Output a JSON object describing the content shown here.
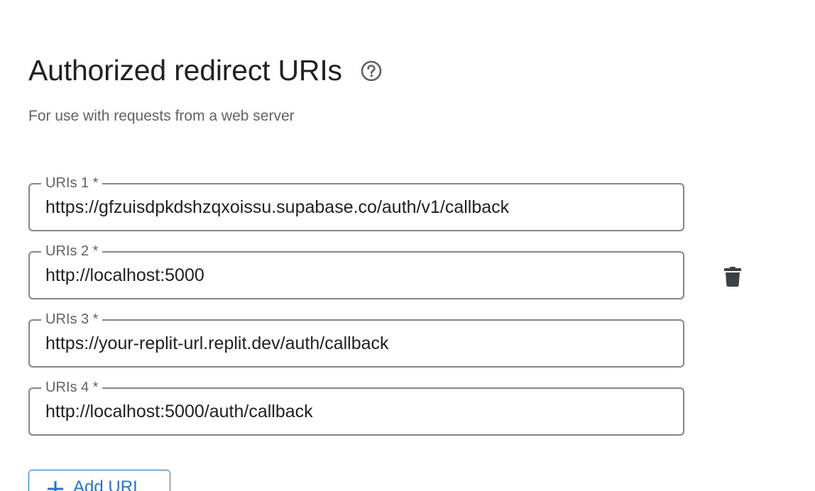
{
  "section": {
    "title": "Authorized redirect URIs",
    "subtitle": "For use with requests from a web server",
    "help_icon": "help-circle-icon"
  },
  "uris": [
    {
      "label": "URIs 1 *",
      "value": "https://gfzuisdpkdshzqxoissu.supabase.co/auth/v1/callback"
    },
    {
      "label": "URIs 2 *",
      "value": "http://localhost:5000"
    },
    {
      "label": "URIs 3 *",
      "value": "https://your-replit-url.replit.dev/auth/callback"
    },
    {
      "label": "URIs 4 *",
      "value": "http://localhost:5000/auth/callback"
    }
  ],
  "delete_icon": "trash-icon",
  "add_button": {
    "label": "Add URI",
    "icon": "plus-icon"
  },
  "colors": {
    "accent": "#1a73e8",
    "border": "#80868b",
    "text": "#202124",
    "secondary_text": "#5f6368"
  }
}
